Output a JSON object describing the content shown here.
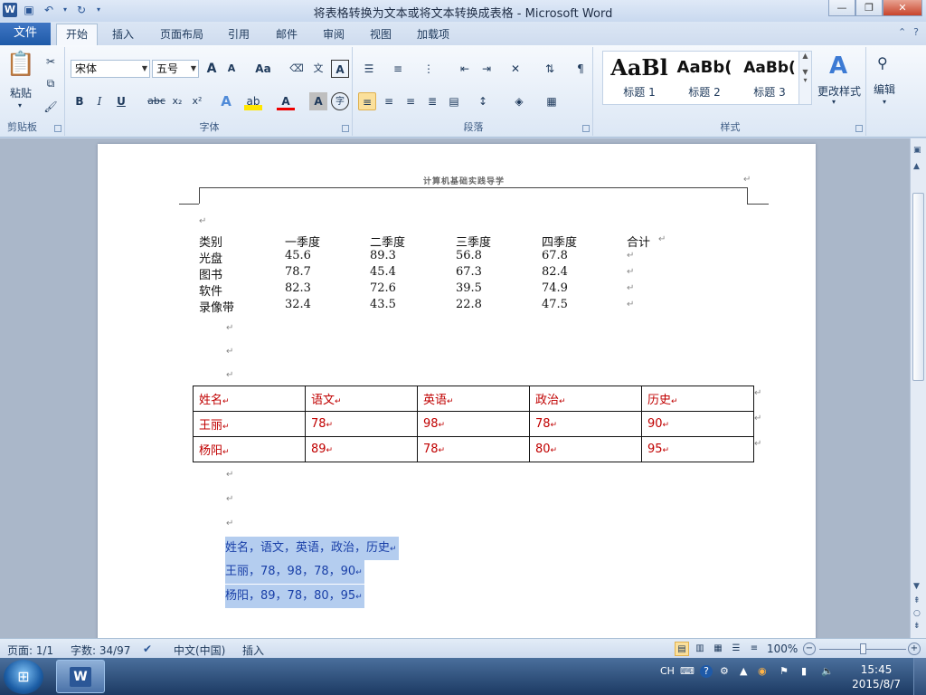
{
  "window": {
    "title": "将表格转换为文本或将文本转换成表格 - Microsoft Word",
    "app_icon": "W"
  },
  "tabs": {
    "file": "文件",
    "items": [
      "开始",
      "插入",
      "页面布局",
      "引用",
      "邮件",
      "审阅",
      "视图",
      "加载项"
    ]
  },
  "ribbon": {
    "clipboard": {
      "paste": "粘贴",
      "label": "剪贴板"
    },
    "font": {
      "font_name": "宋体",
      "font_size": "五号",
      "grow": "A",
      "shrink": "A",
      "change_case": "Aa",
      "bold": "B",
      "italic": "I",
      "underline": "U",
      "strike": "abc",
      "subscript": "x₂",
      "superscript": "x²",
      "label": "字体"
    },
    "paragraph": {
      "label": "段落"
    },
    "styles": {
      "items": [
        {
          "preview": "AaBl",
          "name": "标题 1"
        },
        {
          "preview": "AaBb(",
          "name": "标题 2"
        },
        {
          "preview": "AaBb(",
          "name": "标题 3"
        }
      ],
      "change_styles": "更改样式",
      "label": "样式"
    },
    "editing": {
      "label": "编辑"
    }
  },
  "document": {
    "header": "计算机基础实践导学",
    "tab_text": {
      "headers": [
        "类别",
        "一季度",
        "二季度",
        "三季度",
        "四季度",
        "合计"
      ],
      "rows": [
        [
          "光盘",
          "45.6",
          "89.3",
          "56.8",
          "67.8"
        ],
        [
          "图书",
          "78.7",
          "45.4",
          "67.3",
          "82.4"
        ],
        [
          "软件",
          "82.3",
          "72.6",
          "39.5",
          "74.9"
        ],
        [
          "录像带",
          "32.4",
          "43.5",
          "22.8",
          "47.5"
        ]
      ]
    },
    "table": {
      "headers": [
        "姓名",
        "语文",
        "英语",
        "政治",
        "历史"
      ],
      "rows": [
        [
          "王丽",
          "78",
          "98",
          "78",
          "90"
        ],
        [
          "杨阳",
          "89",
          "78",
          "80",
          "95"
        ]
      ]
    },
    "converted_text": [
      "姓名，语文，英语，政治，历史",
      "王丽，78，98，78，90",
      "杨阳，89，78，80，95"
    ],
    "paragraph_mark": "↵",
    "colors": {
      "table_text": "#c00000",
      "highlight": "#b4cdef",
      "highlight_text": "#1a40a8"
    }
  },
  "status": {
    "page": "页面: 1/1",
    "words": "字数: 34/97",
    "language": "中文(中国)",
    "mode": "插入",
    "zoom": "100%",
    "zoom_level": 1.0
  },
  "taskbar": {
    "ime": "CH",
    "time": "15:45",
    "date": "2015/8/7"
  }
}
